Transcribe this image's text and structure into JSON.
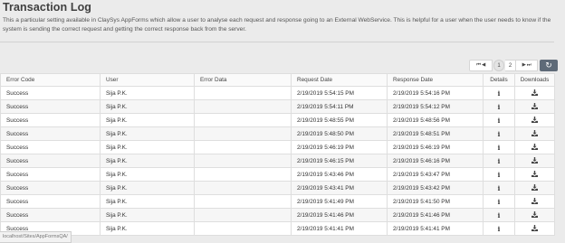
{
  "header": {
    "title": "Transaction Log",
    "description": "This a particular setting available in ClaySys AppForms which allow a user to analyse each request and response going to an External WebService. This is helpful for a user when the user needs to know if the system is sending the correct request and getting the correct response back from the server."
  },
  "pager": {
    "first_prev_glyph": "⏮ ◀",
    "current_page": "1",
    "next_page": "2",
    "next_last_glyph": "▶ ⏭",
    "refresh_glyph": "↻"
  },
  "table": {
    "columns": [
      "Error Code",
      "User",
      "Error Data",
      "Request Date",
      "Response Date",
      "Details",
      "Downloads"
    ],
    "rows": [
      {
        "error_code": "Success",
        "user": "Sija P.K.",
        "error_data": "",
        "request_date": "2/19/2019 5:54:15 PM",
        "response_date": "2/19/2019 5:54:16 PM"
      },
      {
        "error_code": "Success",
        "user": "Sija P.K.",
        "error_data": "",
        "request_date": "2/19/2019 5:54:11 PM",
        "response_date": "2/19/2019 5:54:12 PM"
      },
      {
        "error_code": "Success",
        "user": "Sija P.K.",
        "error_data": "",
        "request_date": "2/19/2019 5:48:55 PM",
        "response_date": "2/19/2019 5:48:56 PM"
      },
      {
        "error_code": "Success",
        "user": "Sija P.K.",
        "error_data": "",
        "request_date": "2/19/2019 5:48:50 PM",
        "response_date": "2/19/2019 5:48:51 PM"
      },
      {
        "error_code": "Success",
        "user": "Sija P.K.",
        "error_data": "",
        "request_date": "2/19/2019 5:46:19 PM",
        "response_date": "2/19/2019 5:46:19 PM"
      },
      {
        "error_code": "Success",
        "user": "Sija P.K.",
        "error_data": "",
        "request_date": "2/19/2019 5:46:15 PM",
        "response_date": "2/19/2019 5:46:16 PM"
      },
      {
        "error_code": "Success",
        "user": "Sija P.K.",
        "error_data": "",
        "request_date": "2/19/2019 5:43:46 PM",
        "response_date": "2/19/2019 5:43:47 PM"
      },
      {
        "error_code": "Success",
        "user": "Sija P.K.",
        "error_data": "",
        "request_date": "2/19/2019 5:43:41 PM",
        "response_date": "2/19/2019 5:43:42 PM"
      },
      {
        "error_code": "Success",
        "user": "Sija P.K.",
        "error_data": "",
        "request_date": "2/19/2019 5:41:49 PM",
        "response_date": "2/19/2019 5:41:50 PM"
      },
      {
        "error_code": "Success",
        "user": "Sija P.K.",
        "error_data": "",
        "request_date": "2/19/2019 5:41:46 PM",
        "response_date": "2/19/2019 5:41:46 PM"
      },
      {
        "error_code": "Success",
        "user": "Sija P.K.",
        "error_data": "",
        "request_date": "2/19/2019 5:41:41 PM",
        "response_date": "2/19/2019 5:41:41 PM"
      }
    ],
    "details_glyph": "i",
    "details_icon": "info-icon",
    "download_icon": "download-icon"
  },
  "status_bar": {
    "url": "localhost/Sites/AppFormsQA/"
  }
}
